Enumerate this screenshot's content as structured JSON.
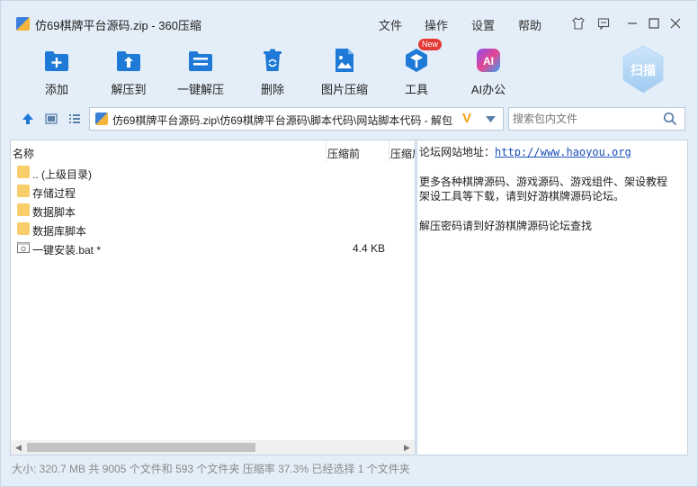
{
  "title": "仿69棋牌平台源码.zip - 360压缩",
  "menu": [
    "文件",
    "操作",
    "设置",
    "帮助"
  ],
  "toolbar": {
    "add": "添加",
    "extract_to": "解压到",
    "one_click_extract": "一键解压",
    "delete": "删除",
    "image_compress": "图片压缩",
    "tools": "工具",
    "tools_badge": "New",
    "ai_office": "AI办公",
    "ai_icon_text": "AI",
    "scan": "扫描"
  },
  "address": {
    "path": "仿69棋牌平台源码.zip\\仿69棋牌平台源码\\脚本代码\\网站脚本代码 - 解包",
    "v_mark": "V"
  },
  "search": {
    "placeholder": "搜索包内文件"
  },
  "columns": {
    "name": "名称",
    "before": "压缩前",
    "after": "压缩后"
  },
  "files": [
    {
      "name": ".. (上级目录)",
      "type": "folder",
      "size": ""
    },
    {
      "name": "存储过程",
      "type": "folder",
      "size": ""
    },
    {
      "name": "数据脚本",
      "type": "folder",
      "size": ""
    },
    {
      "name": "数据库脚本",
      "type": "folder",
      "size": ""
    },
    {
      "name": "一键安装.bat *",
      "type": "bat",
      "size": "4.4 KB"
    }
  ],
  "comment": {
    "line1_label": "论坛网站地址：",
    "line1_link": "http://www.haoyou.org",
    "line2": "更多各种棋牌源码、游戏源码、游戏组件、架设教程",
    "line3": "架设工具等下载，请到好游棋牌源码论坛。",
    "line4": "解压密码请到好游棋牌源码论坛查找"
  },
  "status": "大小: 320.7 MB 共 9005 个文件和 593 个文件夹 压缩率 37.3% 已经选择 1 个文件夹",
  "colors": {
    "accent": "#1e7ad6",
    "window_bg": "#e4eef8",
    "folder": "#f7ce6a",
    "badge": "#e53935"
  }
}
